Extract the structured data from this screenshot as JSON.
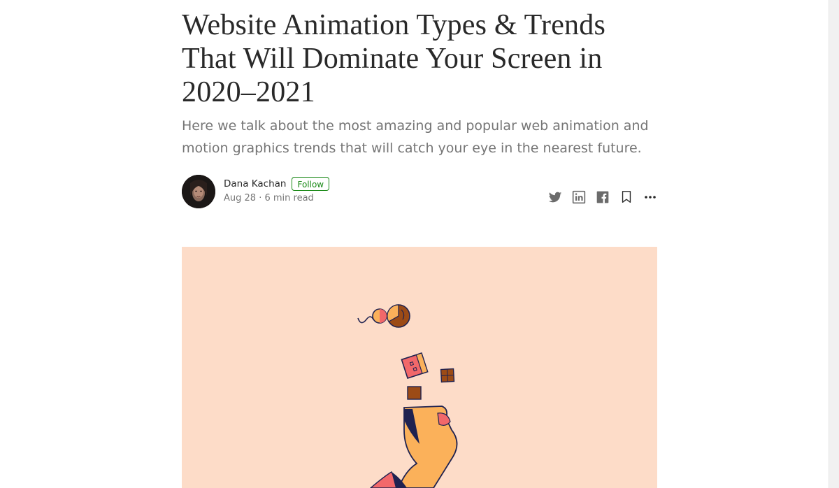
{
  "article": {
    "title": "Website Animation Types & Trends That Will Dominate Your Screen in 2020–2021",
    "subtitle": "Here we talk about the most amazing and popular web animation and motion graphics trends that will catch your eye in the nearest future."
  },
  "author": {
    "name": "Dana Kachan",
    "follow_label": "Follow",
    "date": "Aug 28",
    "read_time": "6 min read",
    "meta_separator": " · "
  },
  "share_actions": [
    {
      "icon": "twitter-icon"
    },
    {
      "icon": "linkedin-icon"
    },
    {
      "icon": "facebook-icon"
    },
    {
      "icon": "bookmark-icon"
    },
    {
      "icon": "more-icon"
    }
  ],
  "colors": {
    "follow_accent": "#1a8917",
    "hero_background": "#fddcc8",
    "illustration_orange": "#fbb15a",
    "illustration_red": "#f2686a",
    "illustration_brown": "#9c4b16",
    "illustration_navy": "#1f2250"
  }
}
